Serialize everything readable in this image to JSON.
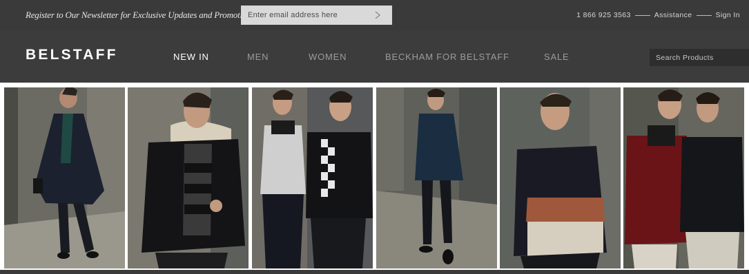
{
  "topbar": {
    "newsletter_text": "Register to Our Newsletter for Exclusive Updates and Promotions",
    "email_placeholder": "Enter email address here",
    "submit_icon": "chevron-right-icon",
    "phone": "1 866 925 3563",
    "assistance": "Assistance",
    "sign_in": "Sign In"
  },
  "navbar": {
    "logo": "BELSTAFF",
    "items": [
      {
        "label": "NEW IN",
        "active": true
      },
      {
        "label": "MEN",
        "active": false
      },
      {
        "label": "WOMEN",
        "active": false
      },
      {
        "label": "BECKHAM FOR BELSTAFF",
        "active": false
      },
      {
        "label": "SALE",
        "active": false
      }
    ],
    "search_placeholder": "Search Products"
  },
  "colors": {
    "topbar_bg": "#3a3a3a",
    "navbar_bg": "#3c3c3c",
    "nav_active": "#ffffff",
    "nav_inactive": "#9c9c9c"
  }
}
